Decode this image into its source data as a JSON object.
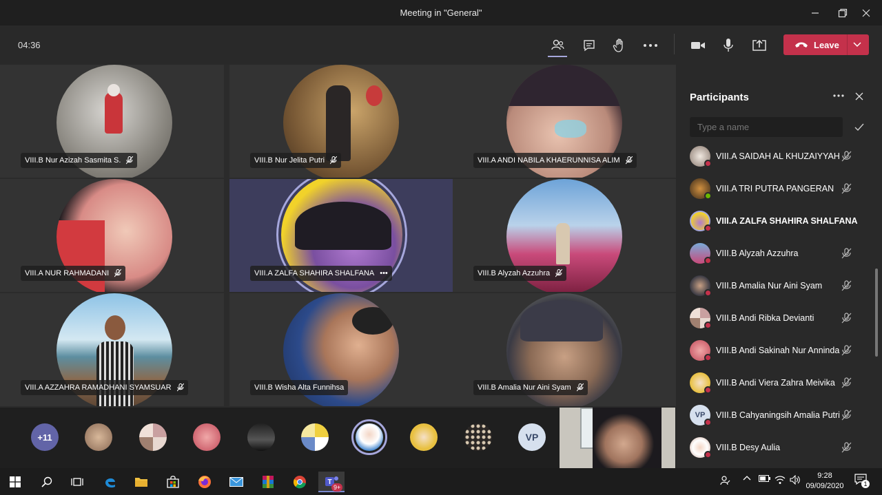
{
  "window": {
    "title": "Meeting in \"General\""
  },
  "toolbar": {
    "timer": "04:36",
    "leave_label": "Leave"
  },
  "tiles": [
    {
      "name": "VIII.B Nur Azizah Sasmita S."
    },
    {
      "name": "VIII.B Nur Jelita Putri"
    },
    {
      "name": "VIII.A ANDI NABILA KHAERUNNISA ALIM"
    },
    {
      "name": "VIII.A NUR RAHMADANI"
    },
    {
      "name": "VIII.A ZALFA SHAHIRA SHALFANA",
      "more": "•••"
    },
    {
      "name": "VIII.B Alyzah Azzuhra"
    },
    {
      "name": "VIII.A AZZAHRA RAMADHANI SYAMSUAR"
    },
    {
      "name": "VIII.B Wisha Alta Funnihsa"
    },
    {
      "name": "VIII.B Amalia Nur Aini Syam"
    }
  ],
  "strip": {
    "overflow_count": "+11",
    "initials": "VP"
  },
  "panel": {
    "title": "Participants",
    "search_placeholder": "Type a name",
    "participants": [
      {
        "name": "VIII.A SAIDAH AL KHUZAIYYAH",
        "status": "#c4314b"
      },
      {
        "name": "VIII.A TRI PUTRA PANGERAN",
        "status": "#6bb700"
      },
      {
        "name": "VIII.A ZALFA SHAHIRA SHALFANA",
        "status": "#c4314b"
      },
      {
        "name": "VIII.B Alyzah Azzuhra",
        "status": "#c4314b"
      },
      {
        "name": "VIII.B Amalia Nur Aini Syam",
        "status": "#c4314b"
      },
      {
        "name": "VIII.B Andi Ribka Devianti",
        "status": "#c4314b"
      },
      {
        "name": "VIII.B Andi Sakinah Nur Anninda",
        "status": "#c4314b"
      },
      {
        "name": "VIII.B Andi Viera Zahra Meivika",
        "status": "#c4314b"
      },
      {
        "name": "VIII.B Cahyaningsih Amalia Putri",
        "status": "#c4314b",
        "initials": "VP"
      },
      {
        "name": "VIII.B Desy Aulia",
        "status": "#c4314b"
      }
    ]
  },
  "taskbar": {
    "time": "9:28",
    "date": "09/09/2020",
    "teams_badge": "9+",
    "notif_count": "1"
  }
}
